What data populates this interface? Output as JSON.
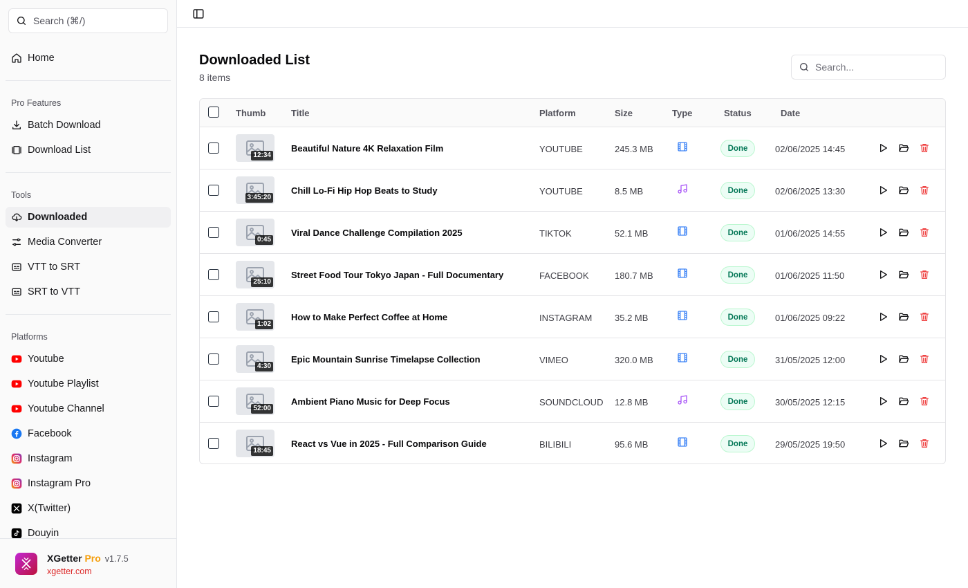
{
  "sidebar": {
    "search_label": "Search (⌘/)",
    "home": "Home",
    "pro_section": "Pro Features",
    "pro_items": [
      "Batch Download",
      "Download List"
    ],
    "tools_section": "Tools",
    "tools_items": [
      "Downloaded",
      "Media Converter",
      "VTT to SRT",
      "SRT to VTT"
    ],
    "platforms_section": "Platforms",
    "platforms_items": [
      "Youtube",
      "Youtube Playlist",
      "Youtube Channel",
      "Facebook",
      "Instagram",
      "Instagram Pro",
      "X(Twitter)",
      "Douyin"
    ],
    "active_item": "Downloaded",
    "footer": {
      "brand": "XGetter",
      "pro": "Pro",
      "version": "v1.7.5",
      "url": "xgetter.com"
    }
  },
  "main": {
    "title": "Downloaded List",
    "count": "8 items",
    "search_placeholder": "Search...",
    "columns": [
      "Thumb",
      "Title",
      "Platform",
      "Size",
      "Type",
      "Status",
      "Date"
    ],
    "rows": [
      {
        "duration": "12:34",
        "title": "Beautiful Nature 4K Relaxation Film",
        "platform": "YOUTUBE",
        "size": "245.3 MB",
        "type": "video",
        "status": "Done",
        "date": "02/06/2025 14:45"
      },
      {
        "duration": "3:45:20",
        "title": "Chill Lo-Fi Hip Hop Beats to Study",
        "platform": "YOUTUBE",
        "size": "8.5 MB",
        "type": "audio",
        "status": "Done",
        "date": "02/06/2025 13:30"
      },
      {
        "duration": "0:45",
        "title": "Viral Dance Challenge Compilation 2025",
        "platform": "TIKTOK",
        "size": "52.1 MB",
        "type": "video",
        "status": "Done",
        "date": "01/06/2025 14:55"
      },
      {
        "duration": "25:10",
        "title": "Street Food Tour Tokyo Japan - Full Documentary",
        "platform": "FACEBOOK",
        "size": "180.7 MB",
        "type": "video",
        "status": "Done",
        "date": "01/06/2025 11:50"
      },
      {
        "duration": "1:02",
        "title": "How to Make Perfect Coffee at Home",
        "platform": "INSTAGRAM",
        "size": "35.2 MB",
        "type": "video",
        "status": "Done",
        "date": "01/06/2025 09:22"
      },
      {
        "duration": "4:30",
        "title": "Epic Mountain Sunrise Timelapse Collection",
        "platform": "VIMEO",
        "size": "320.0 MB",
        "type": "video",
        "status": "Done",
        "date": "31/05/2025 12:00"
      },
      {
        "duration": "52:00",
        "title": "Ambient Piano Music for Deep Focus",
        "platform": "SOUNDCLOUD",
        "size": "12.8 MB",
        "type": "audio",
        "status": "Done",
        "date": "30/05/2025 12:15"
      },
      {
        "duration": "18:45",
        "title": "React vs Vue in 2025 - Full Comparison Guide",
        "platform": "BILIBILI",
        "size": "95.6 MB",
        "type": "video",
        "status": "Done",
        "date": "29/05/2025 19:50"
      }
    ]
  },
  "colors": {
    "video_icon": "#3b82f6",
    "audio_icon": "#a855f7",
    "delete_icon": "#ef4444",
    "status_done_bg": "#ecfdf5",
    "status_done_text": "#047857",
    "youtube": "#ff0000",
    "facebook": "#1877f2",
    "pro_accent": "#f59e0b",
    "url": "#dc2626"
  }
}
